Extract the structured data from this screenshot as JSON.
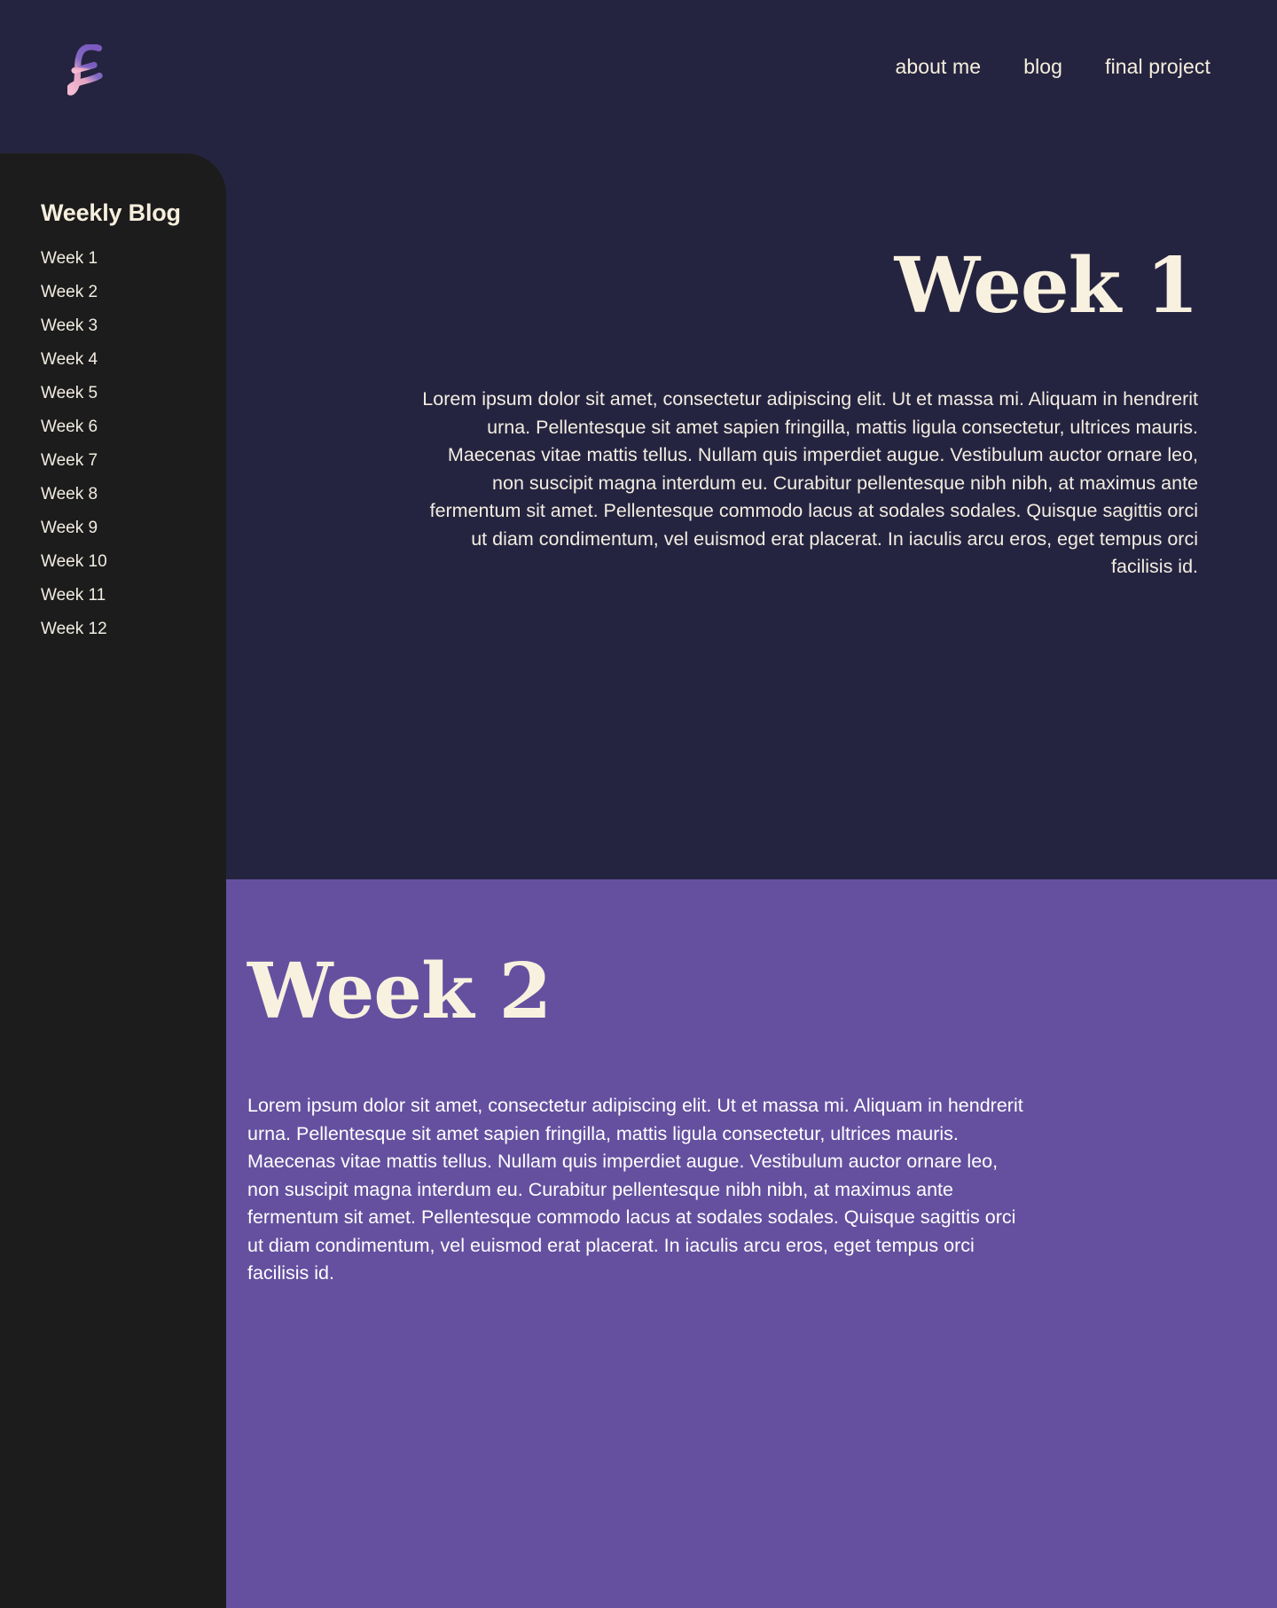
{
  "site": {
    "background_color": "#252440",
    "accent_purple": "#64509F",
    "sidebar_color": "#1C1C1C",
    "cream_color": "#F7EFDD",
    "logo": {
      "name": "script-f-logo",
      "gradient_from": "#6B4FB0",
      "gradient_to": "#F2B7CE"
    }
  },
  "nav": {
    "items": [
      {
        "label": "about me",
        "name": "nav-link-about-me"
      },
      {
        "label": "blog",
        "name": "nav-link-blog"
      },
      {
        "label": "final project",
        "name": "nav-link-final-project"
      }
    ]
  },
  "sidebar": {
    "title": "Weekly Blog",
    "items": [
      {
        "label": "Week 1"
      },
      {
        "label": "Week 2"
      },
      {
        "label": "Week 3"
      },
      {
        "label": "Week 4"
      },
      {
        "label": "Week 5"
      },
      {
        "label": "Week 6"
      },
      {
        "label": "Week 7"
      },
      {
        "label": "Week 8"
      },
      {
        "label": "Week 9"
      },
      {
        "label": "Week 10"
      },
      {
        "label": "Week 11"
      },
      {
        "label": "Week 12"
      }
    ]
  },
  "posts": [
    {
      "title": "Week 1",
      "body": "Lorem ipsum dolor sit amet, consectetur adipiscing elit. Ut et massa mi. Aliquam in hendrerit urna. Pellentesque sit amet sapien fringilla, mattis ligula consectetur, ultrices mauris. Maecenas vitae mattis tellus. Nullam quis imperdiet augue. Vestibulum auctor ornare leo, non suscipit magna interdum eu. Curabitur pellentesque nibh nibh, at maximus ante fermentum sit amet. Pellentesque commodo lacus at sodales sodales. Quisque sagittis orci ut diam condimentum, vel euismod erat placerat. In iaculis arcu eros, eget tempus orci facilisis id.",
      "align": "right",
      "background_color": "#252440"
    },
    {
      "title": "Week 2",
      "body": "Lorem ipsum dolor sit amet, consectetur adipiscing elit. Ut et massa mi. Aliquam in hendrerit urna. Pellentesque sit amet sapien fringilla, mattis ligula consectetur, ultrices mauris. Maecenas vitae mattis tellus. Nullam quis imperdiet augue. Vestibulum auctor ornare leo, non suscipit magna interdum eu. Curabitur pellentesque nibh nibh, at maximus ante fermentum sit amet. Pellentesque commodo lacus at sodales sodales. Quisque sagittis orci ut diam condimentum, vel euismod erat placerat. In iaculis arcu eros, eget tempus orci facilisis id.",
      "align": "left",
      "background_color": "#64509F"
    }
  ]
}
